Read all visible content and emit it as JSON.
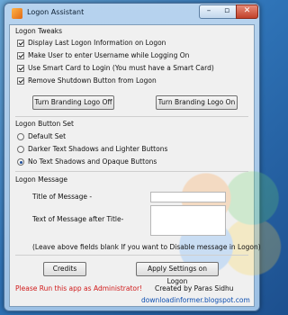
{
  "window": {
    "title": "Logon Assistant",
    "icon": "app-icon"
  },
  "tweaks": {
    "heading": "Logon Tweaks",
    "items": [
      {
        "label": "Display Last Logon Information on Logon",
        "checked": true
      },
      {
        "label": "Make User to enter Username while Logging On",
        "checked": true
      },
      {
        "label": "Use Smart Card to Login (You must have a Smart Card)",
        "checked": true
      },
      {
        "label": "Remove Shutdown Button from Logon",
        "checked": true
      }
    ],
    "branding_off_label": "Turn Branding Logo Off",
    "branding_on_label": "Turn Branding Logo On"
  },
  "buttonset": {
    "heading": "Logon Button Set",
    "options": [
      {
        "label": "Default Set",
        "selected": false
      },
      {
        "label": "Darker Text Shadows and Lighter Buttons",
        "selected": false
      },
      {
        "label": "No Text Shadows and Opaque Buttons",
        "selected": true
      }
    ]
  },
  "message": {
    "heading": "Logon Message",
    "title_label": "Title of Message -",
    "title_value": "",
    "text_label": "Text of Message after Title-",
    "text_value": "",
    "note": "(Leave above fields blank If you want to Disable message in Logon)"
  },
  "footer": {
    "credits_label": "Credits",
    "apply_label": "Apply Settings on Logon",
    "admin_warning": "Please Run this app as Administrator!",
    "created_by": "Created by Paras Sidhu",
    "website": "downloadinformer.blogspot.com"
  },
  "colors": {
    "warning": "#d11a1a",
    "link": "#0b4db0"
  }
}
